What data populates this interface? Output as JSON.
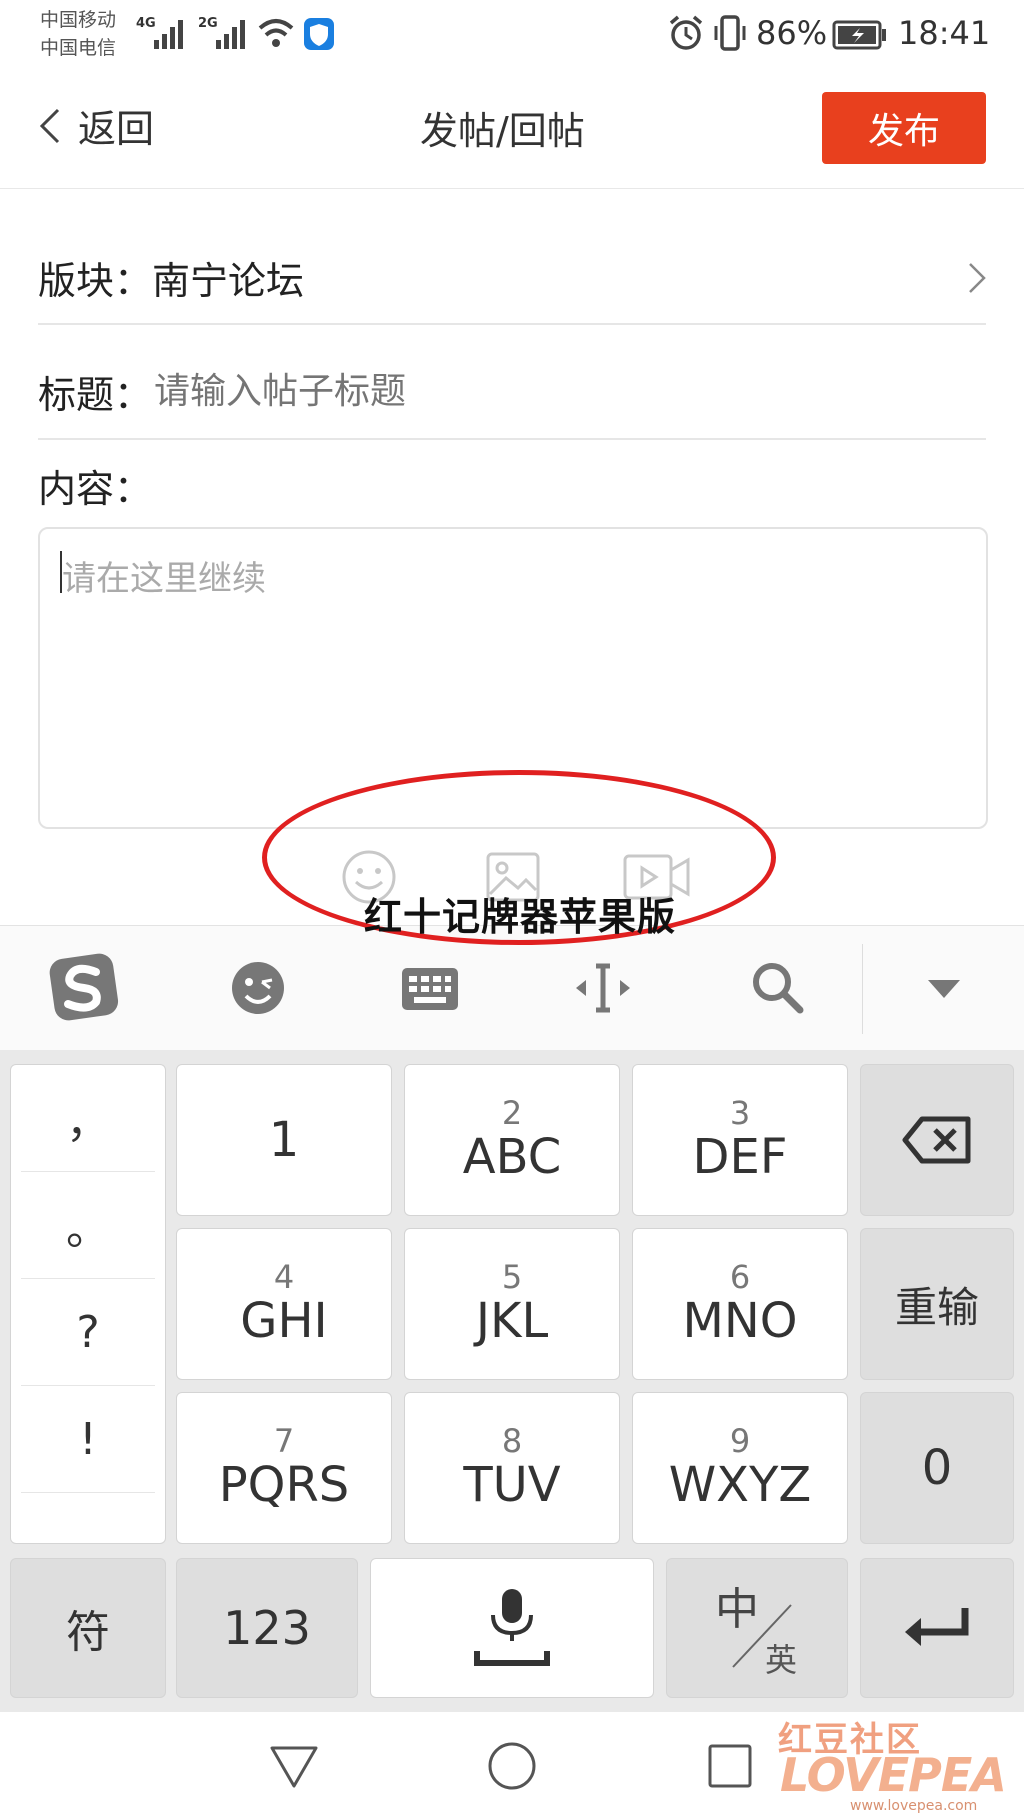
{
  "status_bar": {
    "carrier_1": "中国移动",
    "carrier_2": "中国电信",
    "net_1": "4G",
    "net_2": "2G",
    "battery": "86%",
    "time": "18:41"
  },
  "header": {
    "back_label": "返回",
    "title": "发帖/回帖",
    "publish_label": "发布"
  },
  "form": {
    "section_label": "版块：",
    "section_value": "南宁论坛",
    "title_label": "标题：",
    "title_placeholder": "请输入帖子标题",
    "content_label": "内容：",
    "content_placeholder": "请在这里继续"
  },
  "overlay_text": "红十记牌器苹果版",
  "keyboard": {
    "punctuation": [
      "，",
      "。",
      "?",
      "!"
    ],
    "keys": [
      {
        "num": "",
        "main": "1"
      },
      {
        "num": "2",
        "main": "ABC"
      },
      {
        "num": "3",
        "main": "DEF"
      },
      {
        "num": "4",
        "main": "GHI"
      },
      {
        "num": "5",
        "main": "JKL"
      },
      {
        "num": "6",
        "main": "MNO"
      },
      {
        "num": "7",
        "main": "PQRS"
      },
      {
        "num": "8",
        "main": "TUV"
      },
      {
        "num": "9",
        "main": "WXYZ"
      }
    ],
    "retype": "重输",
    "zero": "0",
    "symbols": "符",
    "numbers": "123",
    "lang_cn": "中",
    "lang_en": "英"
  },
  "watermark": {
    "cn": "红豆社区",
    "en": "LOVEPEA",
    "url": "www.lovepea.com"
  },
  "colors": {
    "accent": "#e8401e",
    "ellipse": "#e02020"
  }
}
